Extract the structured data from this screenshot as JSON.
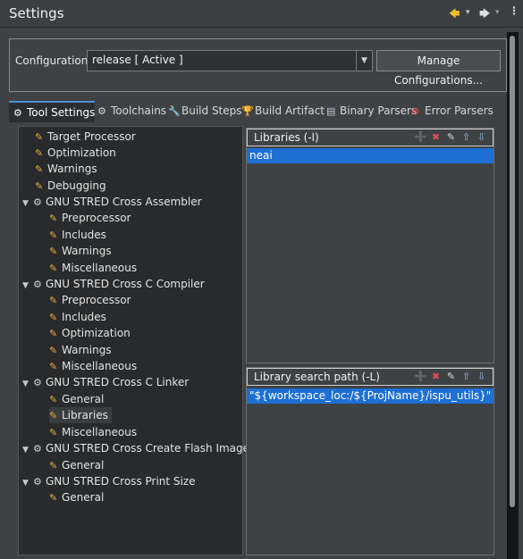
{
  "header": {
    "title": "Settings",
    "nav": {
      "back": "🡄",
      "back_dropdown": "▾",
      "forward": "🡆",
      "forward_dropdown": "▾",
      "menu": "⋮"
    }
  },
  "config": {
    "label": "Configuration:",
    "selected": "release  [ Active ]",
    "manage_label": "Manage Configurations..."
  },
  "tabs": [
    {
      "label": "Tool Settings",
      "icon": "gear-icon",
      "active": true
    },
    {
      "label": "Toolchains",
      "icon": "gear-icon"
    },
    {
      "label": "Build Steps",
      "icon": "wrench-icon"
    },
    {
      "label": "Build Artifact",
      "icon": "trophy-icon"
    },
    {
      "label": "Binary Parsers",
      "icon": "binary-icon"
    },
    {
      "label": "Error Parsers",
      "icon": "error-icon"
    }
  ],
  "tree": [
    {
      "label": "Target Processor"
    },
    {
      "label": "Optimization"
    },
    {
      "label": "Warnings"
    },
    {
      "label": "Debugging"
    },
    {
      "label": "GNU STRED Cross Assembler"
    },
    {
      "label": "Preprocessor"
    },
    {
      "label": "Includes"
    },
    {
      "label": "Warnings"
    },
    {
      "label": "Miscellaneous"
    },
    {
      "label": "GNU STRED Cross C Compiler"
    },
    {
      "label": "Preprocessor"
    },
    {
      "label": "Includes"
    },
    {
      "label": "Optimization"
    },
    {
      "label": "Warnings"
    },
    {
      "label": "Miscellaneous"
    },
    {
      "label": "GNU STRED Cross C Linker"
    },
    {
      "label": "General"
    },
    {
      "label": "Libraries"
    },
    {
      "label": "Miscellaneous"
    },
    {
      "label": "GNU STRED Cross Create Flash Image"
    },
    {
      "label": "General"
    },
    {
      "label": "GNU STRED Cross Print Size"
    },
    {
      "label": "General"
    }
  ],
  "libraries_panel": {
    "title": "Libraries (-l)",
    "items": [
      "neai"
    ]
  },
  "search_panel": {
    "title": "Library search path (-L)",
    "items": [
      "\"${workspace_loc:/${ProjName}/ispu_utils}\""
    ]
  },
  "colors": {
    "accent": "#1e6fd3",
    "folder_icon": "#e8b040",
    "nav_back": "#f0c030"
  }
}
